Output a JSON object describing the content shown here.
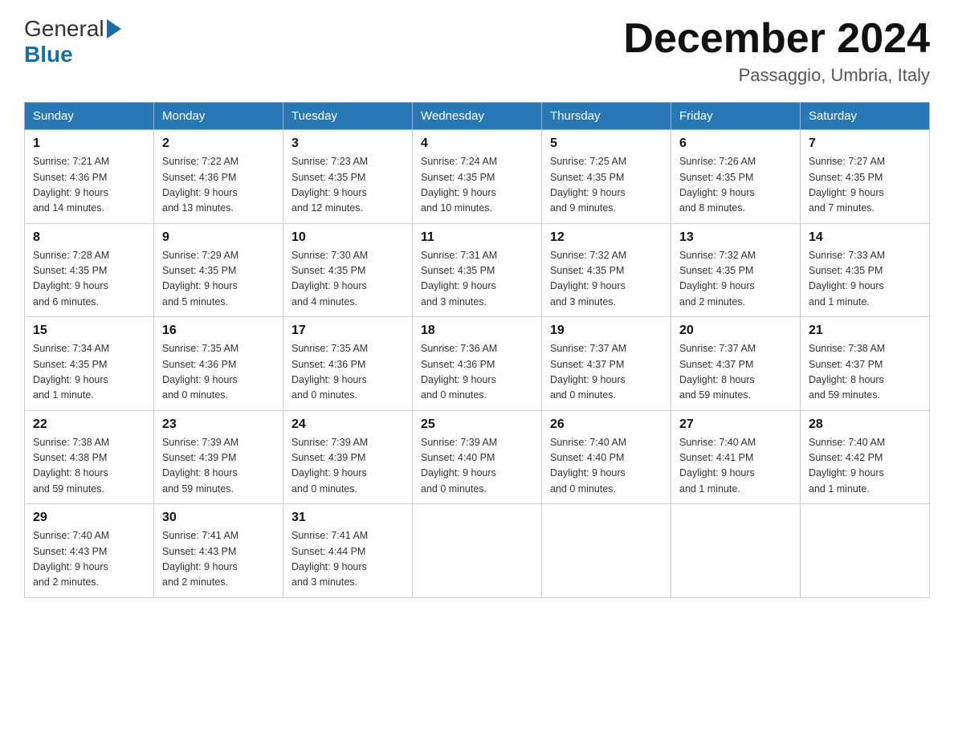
{
  "header": {
    "logo_general": "General",
    "logo_blue": "Blue",
    "month_title": "December 2024",
    "location": "Passaggio, Umbria, Italy"
  },
  "columns": [
    "Sunday",
    "Monday",
    "Tuesday",
    "Wednesday",
    "Thursday",
    "Friday",
    "Saturday"
  ],
  "weeks": [
    [
      {
        "day": "1",
        "line1": "Sunrise: 7:21 AM",
        "line2": "Sunset: 4:36 PM",
        "line3": "Daylight: 9 hours",
        "line4": "and 14 minutes."
      },
      {
        "day": "2",
        "line1": "Sunrise: 7:22 AM",
        "line2": "Sunset: 4:36 PM",
        "line3": "Daylight: 9 hours",
        "line4": "and 13 minutes."
      },
      {
        "day": "3",
        "line1": "Sunrise: 7:23 AM",
        "line2": "Sunset: 4:35 PM",
        "line3": "Daylight: 9 hours",
        "line4": "and 12 minutes."
      },
      {
        "day": "4",
        "line1": "Sunrise: 7:24 AM",
        "line2": "Sunset: 4:35 PM",
        "line3": "Daylight: 9 hours",
        "line4": "and 10 minutes."
      },
      {
        "day": "5",
        "line1": "Sunrise: 7:25 AM",
        "line2": "Sunset: 4:35 PM",
        "line3": "Daylight: 9 hours",
        "line4": "and 9 minutes."
      },
      {
        "day": "6",
        "line1": "Sunrise: 7:26 AM",
        "line2": "Sunset: 4:35 PM",
        "line3": "Daylight: 9 hours",
        "line4": "and 8 minutes."
      },
      {
        "day": "7",
        "line1": "Sunrise: 7:27 AM",
        "line2": "Sunset: 4:35 PM",
        "line3": "Daylight: 9 hours",
        "line4": "and 7 minutes."
      }
    ],
    [
      {
        "day": "8",
        "line1": "Sunrise: 7:28 AM",
        "line2": "Sunset: 4:35 PM",
        "line3": "Daylight: 9 hours",
        "line4": "and 6 minutes."
      },
      {
        "day": "9",
        "line1": "Sunrise: 7:29 AM",
        "line2": "Sunset: 4:35 PM",
        "line3": "Daylight: 9 hours",
        "line4": "and 5 minutes."
      },
      {
        "day": "10",
        "line1": "Sunrise: 7:30 AM",
        "line2": "Sunset: 4:35 PM",
        "line3": "Daylight: 9 hours",
        "line4": "and 4 minutes."
      },
      {
        "day": "11",
        "line1": "Sunrise: 7:31 AM",
        "line2": "Sunset: 4:35 PM",
        "line3": "Daylight: 9 hours",
        "line4": "and 3 minutes."
      },
      {
        "day": "12",
        "line1": "Sunrise: 7:32 AM",
        "line2": "Sunset: 4:35 PM",
        "line3": "Daylight: 9 hours",
        "line4": "and 3 minutes."
      },
      {
        "day": "13",
        "line1": "Sunrise: 7:32 AM",
        "line2": "Sunset: 4:35 PM",
        "line3": "Daylight: 9 hours",
        "line4": "and 2 minutes."
      },
      {
        "day": "14",
        "line1": "Sunrise: 7:33 AM",
        "line2": "Sunset: 4:35 PM",
        "line3": "Daylight: 9 hours",
        "line4": "and 1 minute."
      }
    ],
    [
      {
        "day": "15",
        "line1": "Sunrise: 7:34 AM",
        "line2": "Sunset: 4:35 PM",
        "line3": "Daylight: 9 hours",
        "line4": "and 1 minute."
      },
      {
        "day": "16",
        "line1": "Sunrise: 7:35 AM",
        "line2": "Sunset: 4:36 PM",
        "line3": "Daylight: 9 hours",
        "line4": "and 0 minutes."
      },
      {
        "day": "17",
        "line1": "Sunrise: 7:35 AM",
        "line2": "Sunset: 4:36 PM",
        "line3": "Daylight: 9 hours",
        "line4": "and 0 minutes."
      },
      {
        "day": "18",
        "line1": "Sunrise: 7:36 AM",
        "line2": "Sunset: 4:36 PM",
        "line3": "Daylight: 9 hours",
        "line4": "and 0 minutes."
      },
      {
        "day": "19",
        "line1": "Sunrise: 7:37 AM",
        "line2": "Sunset: 4:37 PM",
        "line3": "Daylight: 9 hours",
        "line4": "and 0 minutes."
      },
      {
        "day": "20",
        "line1": "Sunrise: 7:37 AM",
        "line2": "Sunset: 4:37 PM",
        "line3": "Daylight: 8 hours",
        "line4": "and 59 minutes."
      },
      {
        "day": "21",
        "line1": "Sunrise: 7:38 AM",
        "line2": "Sunset: 4:37 PM",
        "line3": "Daylight: 8 hours",
        "line4": "and 59 minutes."
      }
    ],
    [
      {
        "day": "22",
        "line1": "Sunrise: 7:38 AM",
        "line2": "Sunset: 4:38 PM",
        "line3": "Daylight: 8 hours",
        "line4": "and 59 minutes."
      },
      {
        "day": "23",
        "line1": "Sunrise: 7:39 AM",
        "line2": "Sunset: 4:39 PM",
        "line3": "Daylight: 8 hours",
        "line4": "and 59 minutes."
      },
      {
        "day": "24",
        "line1": "Sunrise: 7:39 AM",
        "line2": "Sunset: 4:39 PM",
        "line3": "Daylight: 9 hours",
        "line4": "and 0 minutes."
      },
      {
        "day": "25",
        "line1": "Sunrise: 7:39 AM",
        "line2": "Sunset: 4:40 PM",
        "line3": "Daylight: 9 hours",
        "line4": "and 0 minutes."
      },
      {
        "day": "26",
        "line1": "Sunrise: 7:40 AM",
        "line2": "Sunset: 4:40 PM",
        "line3": "Daylight: 9 hours",
        "line4": "and 0 minutes."
      },
      {
        "day": "27",
        "line1": "Sunrise: 7:40 AM",
        "line2": "Sunset: 4:41 PM",
        "line3": "Daylight: 9 hours",
        "line4": "and 1 minute."
      },
      {
        "day": "28",
        "line1": "Sunrise: 7:40 AM",
        "line2": "Sunset: 4:42 PM",
        "line3": "Daylight: 9 hours",
        "line4": "and 1 minute."
      }
    ],
    [
      {
        "day": "29",
        "line1": "Sunrise: 7:40 AM",
        "line2": "Sunset: 4:43 PM",
        "line3": "Daylight: 9 hours",
        "line4": "and 2 minutes."
      },
      {
        "day": "30",
        "line1": "Sunrise: 7:41 AM",
        "line2": "Sunset: 4:43 PM",
        "line3": "Daylight: 9 hours",
        "line4": "and 2 minutes."
      },
      {
        "day": "31",
        "line1": "Sunrise: 7:41 AM",
        "line2": "Sunset: 4:44 PM",
        "line3": "Daylight: 9 hours",
        "line4": "and 3 minutes."
      },
      null,
      null,
      null,
      null
    ]
  ]
}
